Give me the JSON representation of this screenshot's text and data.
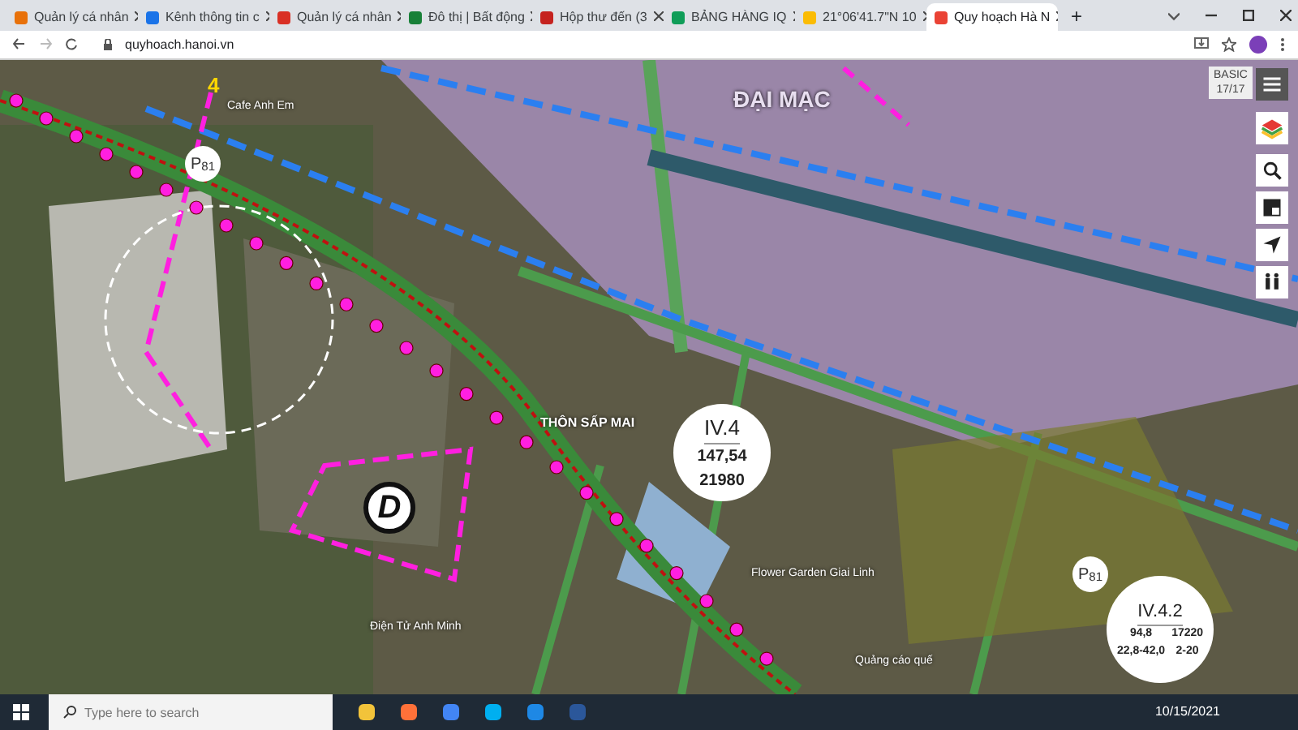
{
  "browser": {
    "tabs": [
      {
        "title": "Quản lý cá nhân",
        "selected": false
      },
      {
        "title": "Kênh thông tin c",
        "selected": false
      },
      {
        "title": "Quản lý cá nhân",
        "selected": false
      },
      {
        "title": "Đô thị | Bất động",
        "selected": false
      },
      {
        "title": "Hộp thư đến (3",
        "selected": false
      },
      {
        "title": "BẢNG HÀNG IQ",
        "selected": false
      },
      {
        "title": "21°06'41.7\"N 10",
        "selected": false
      },
      {
        "title": "Quy hoạch Hà N",
        "selected": true
      }
    ],
    "new_tab": "+",
    "address": "quyhoach.hanoi.vn"
  },
  "map": {
    "labels": [
      {
        "text": "ĐẠI MẠC",
        "kind": "area"
      },
      {
        "text": "THÔN SẤP MAI",
        "kind": "area"
      },
      {
        "text": "Cafe Anh Em",
        "kind": "place"
      },
      {
        "text": "Điện Tử Anh Minh",
        "kind": "place"
      },
      {
        "text": "Flower Garden Giai Linh",
        "kind": "place"
      },
      {
        "text": "Quảng cáo quế",
        "kind": "place"
      }
    ],
    "zones": [
      {
        "code": "IV.4",
        "values": [
          "147,54",
          "21980"
        ]
      },
      {
        "code": "IV.4.2",
        "values": [
          "94,8",
          "17220",
          "22,8-42,0",
          "2-20"
        ]
      }
    ],
    "parking": [
      "P$_{81}$",
      "P$_{81}$"
    ],
    "plot_letter": "D",
    "plot_number": "4",
    "basemap": {
      "name": "BASIC",
      "count": "17/17"
    }
  },
  "taskbar": {
    "search_placeholder": "Type here to search",
    "date": "10/15/2021"
  }
}
